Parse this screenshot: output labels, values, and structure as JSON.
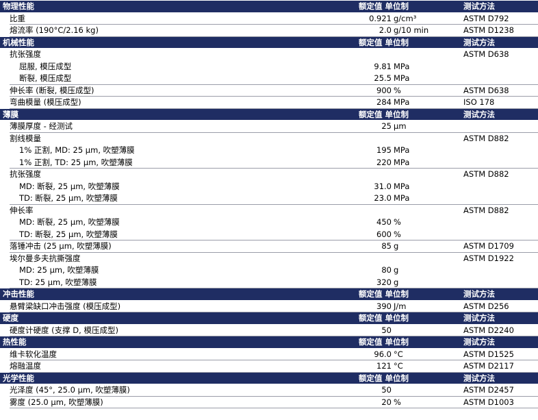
{
  "header_labels": {
    "value": "额定值 单位制",
    "method": "测试方法"
  },
  "sections": [
    {
      "title": "物理性能",
      "rows": [
        {
          "prop": "比重",
          "num": "0.921",
          "unit": "g/cm³",
          "std": "ASTM D792"
        },
        {
          "prop": "熔流率 (190°C/2.16 kg)",
          "num": "2.0",
          "unit": "g/10 min",
          "std": "ASTM D1238"
        }
      ]
    },
    {
      "title": "机械性能",
      "rows": [
        {
          "prop": "抗张强度",
          "num": "",
          "unit": "",
          "std": "ASTM D638",
          "group": true
        },
        {
          "prop": "屈服, 模压成型",
          "num": "9.81",
          "unit": "MPa",
          "std": "",
          "sub": true
        },
        {
          "prop": "断裂, 模压成型",
          "num": "25.5",
          "unit": "MPa",
          "std": "",
          "sub": true,
          "last": true
        },
        {
          "prop": "伸长率 (断裂, 模压成型)",
          "num": "900",
          "unit": "%",
          "std": "ASTM D638"
        },
        {
          "prop": "弯曲模量 (模压成型)",
          "num": "284",
          "unit": "MPa",
          "std": "ISO 178"
        }
      ]
    },
    {
      "title": "薄膜",
      "rows": [
        {
          "prop": "薄膜厚度 - 经测试",
          "num": "25",
          "unit": "µm",
          "std": ""
        },
        {
          "prop": "割线模量",
          "num": "",
          "unit": "",
          "std": "ASTM D882",
          "group": true
        },
        {
          "prop": "1% 正割, MD: 25 µm, 吹塑薄膜",
          "num": "195",
          "unit": "MPa",
          "std": "",
          "sub": true
        },
        {
          "prop": "1% 正割, TD: 25 µm, 吹塑薄膜",
          "num": "220",
          "unit": "MPa",
          "std": "",
          "sub": true,
          "last": true
        },
        {
          "prop": "抗张强度",
          "num": "",
          "unit": "",
          "std": "ASTM D882",
          "group": true
        },
        {
          "prop": "MD: 断裂, 25 µm, 吹塑薄膜",
          "num": "31.0",
          "unit": "MPa",
          "std": "",
          "sub": true
        },
        {
          "prop": "TD: 断裂, 25 µm, 吹塑薄膜",
          "num": "23.0",
          "unit": "MPa",
          "std": "",
          "sub": true,
          "last": true
        },
        {
          "prop": "伸长率",
          "num": "",
          "unit": "",
          "std": "ASTM D882",
          "group": true
        },
        {
          "prop": "MD: 断裂, 25 µm, 吹塑薄膜",
          "num": "450",
          "unit": "%",
          "std": "",
          "sub": true
        },
        {
          "prop": "TD: 断裂, 25 µm, 吹塑薄膜",
          "num": "600",
          "unit": "%",
          "std": "",
          "sub": true,
          "last": true
        },
        {
          "prop": "落锤冲击 (25 µm, 吹塑薄膜)",
          "num": "85",
          "unit": "g",
          "std": "ASTM D1709"
        },
        {
          "prop": "埃尔曼多夫抗撕强度",
          "num": "",
          "unit": "",
          "std": "ASTM D1922",
          "group": true
        },
        {
          "prop": "MD: 25 µm, 吹塑薄膜",
          "num": "80",
          "unit": "g",
          "std": "",
          "sub": true
        },
        {
          "prop": "TD: 25 µm, 吹塑薄膜",
          "num": "320",
          "unit": "g",
          "std": "",
          "sub": true,
          "last": true
        }
      ]
    },
    {
      "title": "冲击性能",
      "rows": [
        {
          "prop": "悬臂梁缺口冲击强度 (模压成型)",
          "num": "390",
          "unit": "J/m",
          "std": "ASTM D256"
        }
      ]
    },
    {
      "title": "硬度",
      "rows": [
        {
          "prop": "硬度计硬度 (支撑 D, 模压成型)",
          "num": "50",
          "unit": "",
          "std": "ASTM D2240"
        }
      ]
    },
    {
      "title": "热性能",
      "rows": [
        {
          "prop": "维卡软化温度",
          "num": "96.0",
          "unit": "°C",
          "std": "ASTM D1525"
        },
        {
          "prop": "熔融温度",
          "num": "121",
          "unit": "°C",
          "std": "ASTM D2117"
        }
      ]
    },
    {
      "title": "光学性能",
      "rows": [
        {
          "prop": "光泽度 (45°, 25.0 µm, 吹塑薄膜)",
          "num": "50",
          "unit": "",
          "std": "ASTM D2457"
        },
        {
          "prop": "雾度 (25.0 µm, 吹塑薄膜)",
          "num": "20",
          "unit": "%",
          "std": "ASTM D1003"
        }
      ]
    }
  ]
}
